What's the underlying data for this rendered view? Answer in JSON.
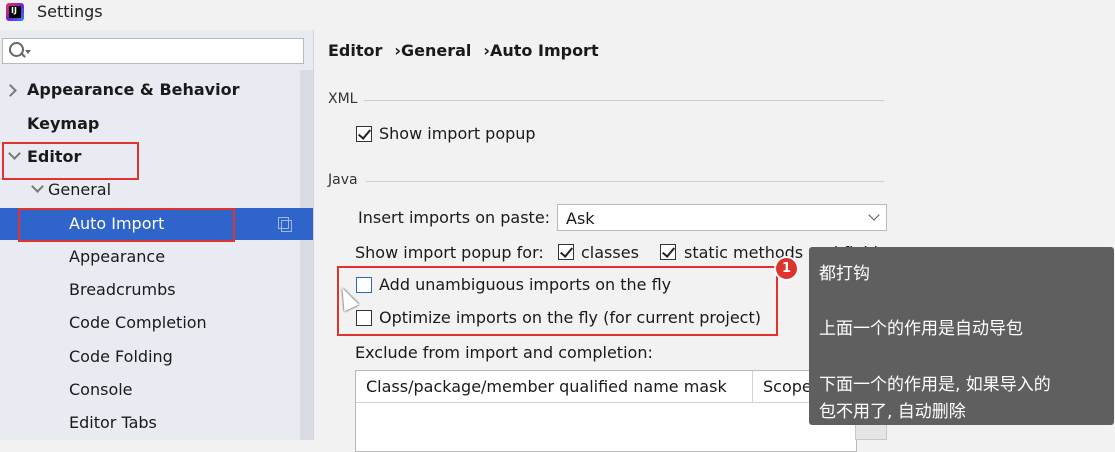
{
  "window": {
    "title": "Settings"
  },
  "search": {
    "placeholder": "",
    "value": ""
  },
  "sidebar": {
    "items": [
      {
        "label": "Appearance & Behavior"
      },
      {
        "label": "Keymap"
      },
      {
        "label": "Editor"
      },
      {
        "label": "General"
      },
      {
        "label": "Auto Import"
      },
      {
        "label": "Appearance"
      },
      {
        "label": "Breadcrumbs"
      },
      {
        "label": "Code Completion"
      },
      {
        "label": "Code Folding"
      },
      {
        "label": "Console"
      },
      {
        "label": "Editor Tabs"
      }
    ]
  },
  "breadcrumb": [
    "Editor",
    "General",
    "Auto Import"
  ],
  "xml": {
    "section": "XML",
    "show_import_popup": {
      "label": "Show import popup",
      "checked": true
    }
  },
  "java": {
    "section": "Java",
    "insert_on_paste": {
      "label": "Insert imports on paste:",
      "value": "Ask"
    },
    "show_popup_for": {
      "label": "Show import popup for:",
      "classes": {
        "label": "classes",
        "checked": true
      },
      "static": {
        "label": "static methods and fields",
        "checked": true
      }
    },
    "add_unambiguous": {
      "label": "Add unambiguous imports on the fly",
      "checked": false
    },
    "optimize": {
      "label": "Optimize imports on the fly (for current project)",
      "checked": false
    },
    "exclude_label": "Exclude from import and completion:",
    "table": {
      "columns": [
        "Class/package/member qualified name mask",
        "Scope"
      ],
      "add_label": "+"
    }
  },
  "annotation": {
    "badge": "1",
    "lines": [
      "都打钩",
      "上面一个的作用是自动导包",
      "下面一个的作用是, 如果导入的",
      "包不用了, 自动删除"
    ]
  },
  "colors": {
    "selection": "#2f65ca",
    "highlight_box": "#e0322e",
    "tooltip_bg": "#5f5f5f"
  }
}
